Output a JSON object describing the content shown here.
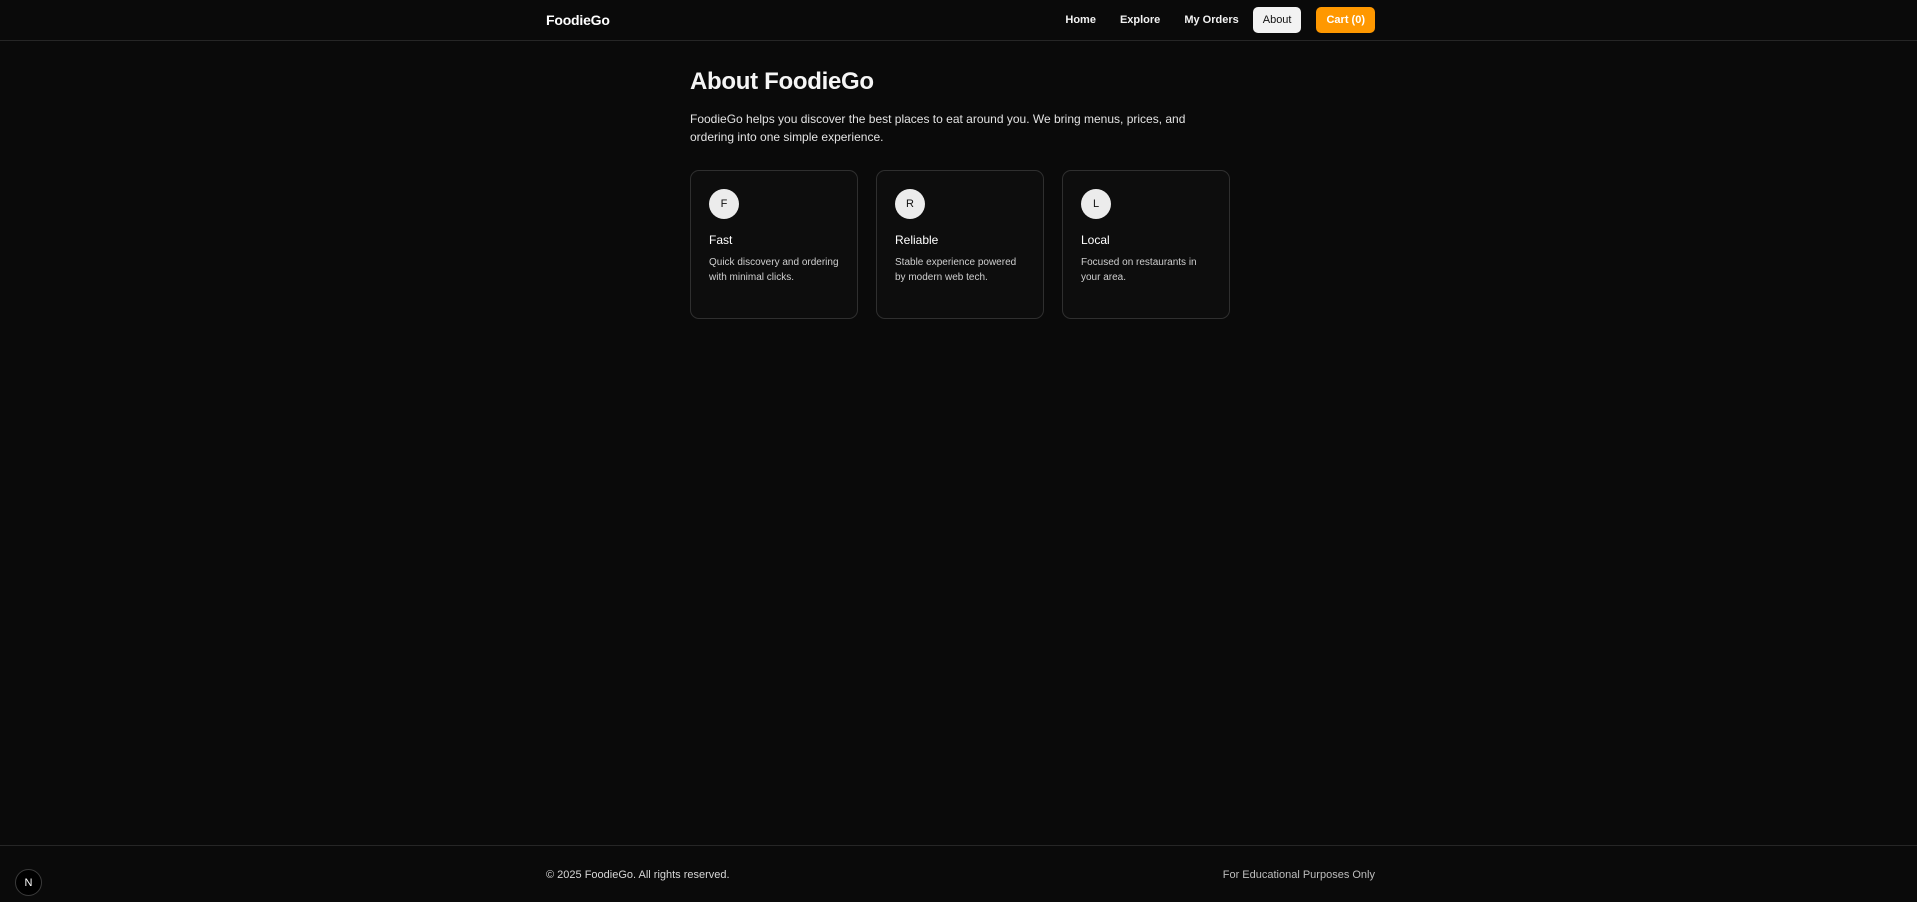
{
  "header": {
    "brand": "FoodieGo",
    "nav": [
      {
        "label": "Home"
      },
      {
        "label": "Explore"
      },
      {
        "label": "My Orders"
      },
      {
        "label": "About"
      }
    ],
    "cart_label": "Cart (0)"
  },
  "main": {
    "title": "About FoodieGo",
    "intro": "FoodieGo helps you discover the best places to eat around you. We bring menus, prices, and ordering into one simple experience.",
    "cards": [
      {
        "badge": "F",
        "title": "Fast",
        "text": "Quick discovery and ordering with minimal clicks."
      },
      {
        "badge": "R",
        "title": "Reliable",
        "text": "Stable experience powered by modern web tech."
      },
      {
        "badge": "L",
        "title": "Local",
        "text": "Focused on restaurants in your area."
      }
    ]
  },
  "footer": {
    "copyright": "© 2025 FoodieGo. All rights reserved.",
    "note": "For Educational Purposes Only"
  },
  "dev_badge": {
    "letter": "N",
    "icon": "nextjs-icon"
  },
  "colors": {
    "background": "#0a0a0a",
    "accent": "#ff9800",
    "active_nav_bg": "#f2f2f2"
  }
}
